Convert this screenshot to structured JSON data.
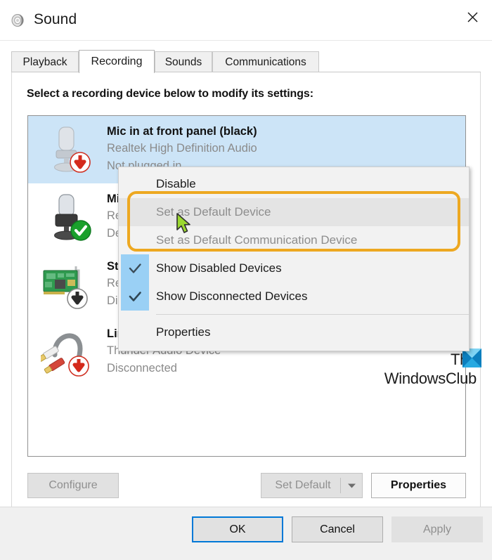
{
  "window": {
    "title": "Sound",
    "icon": "speaker-icon",
    "close_label": "✕"
  },
  "tabs": [
    {
      "label": "Playback",
      "active": false
    },
    {
      "label": "Recording",
      "active": true
    },
    {
      "label": "Sounds",
      "active": false
    },
    {
      "label": "Communications",
      "active": false
    }
  ],
  "prompt": "Select a recording device below to modify its settings:",
  "devices": [
    {
      "name": "Mic in at front panel (black)",
      "driver": "Realtek High Definition Audio",
      "status": "Not plugged in",
      "icon": "microphone-disabled-icon",
      "badge": "red-down-arrow",
      "selected": true
    },
    {
      "name": "Microphone",
      "driver": "Realtek High Definition Audio",
      "status": "Default Device",
      "icon": "microphone-icon",
      "badge": "green-check",
      "selected": false
    },
    {
      "name": "Stereo Mix",
      "driver": "Realtek High Definition Audio",
      "status": "Disabled",
      "icon": "sound-card-icon",
      "badge": "gray-down-arrow",
      "selected": false
    },
    {
      "name": "Line In",
      "driver": "Thunder Audio Device",
      "status": "Disconnected",
      "icon": "rca-cable-icon",
      "badge": "red-down-arrow",
      "selected": false
    }
  ],
  "context_menu": {
    "items": [
      {
        "label": "Disable",
        "disabled": false,
        "checked": false,
        "highlighted": false
      },
      {
        "label": "Set as Default Device",
        "disabled": true,
        "checked": false,
        "highlighted": true
      },
      {
        "label": "Set as Default Communication Device",
        "disabled": true,
        "checked": false,
        "highlighted": false
      },
      {
        "label": "Show Disabled Devices",
        "disabled": false,
        "checked": true,
        "highlighted": false
      },
      {
        "label": "Show Disconnected Devices",
        "disabled": false,
        "checked": true,
        "highlighted": false
      },
      {
        "label": "Properties",
        "disabled": false,
        "checked": false,
        "highlighted": false
      }
    ],
    "highlight_color": "#eda821"
  },
  "watermark": {
    "line1": "The",
    "line2": "WindowsClub",
    "logo": "windowsclub-logo"
  },
  "buttons": {
    "configure": "Configure",
    "set_default": "Set Default",
    "set_default_arrow": "▼",
    "properties": "Properties",
    "ok": "OK",
    "cancel": "Cancel",
    "apply": "Apply"
  },
  "colors": {
    "selection_blue": "#cce4f7",
    "check_blue": "#9ad0f5",
    "focus_blue": "#0078d7",
    "accent_orange": "#eda821",
    "green_badge": "#1aa02c",
    "red_badge": "#d42a1c"
  }
}
